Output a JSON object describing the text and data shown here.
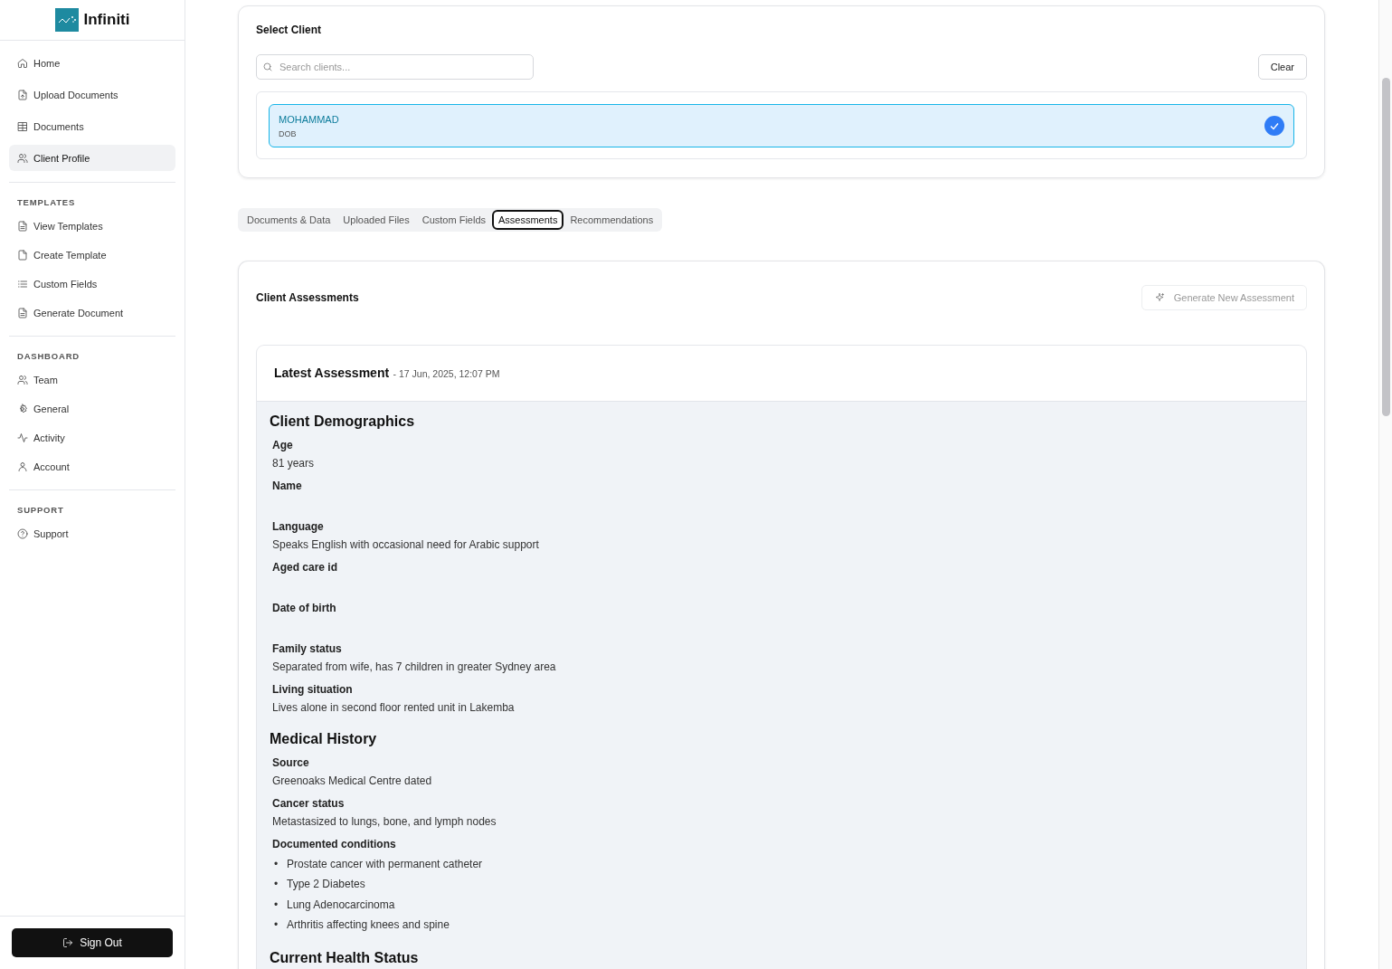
{
  "brand": {
    "name": "Infiniti"
  },
  "sidebar": {
    "items": [
      {
        "label": "Home",
        "selected": false
      },
      {
        "label": "Upload Documents",
        "selected": false
      },
      {
        "label": "Documents",
        "selected": false
      },
      {
        "label": "Client Profile",
        "selected": true
      }
    ],
    "sections": [
      {
        "title": "TEMPLATES",
        "items": [
          {
            "label": "View Templates",
            "selected": false
          },
          {
            "label": "Create Template",
            "selected": false
          },
          {
            "label": "Custom Fields",
            "selected": false
          },
          {
            "label": "Generate Document",
            "selected": false
          }
        ]
      },
      {
        "title": "DASHBOARD",
        "items": [
          {
            "label": "Team",
            "selected": false
          },
          {
            "label": "General",
            "selected": false
          },
          {
            "label": "Activity",
            "selected": false
          },
          {
            "label": "Account",
            "selected": false
          }
        ]
      },
      {
        "title": "SUPPORT",
        "items": [
          {
            "label": "Support",
            "selected": false
          }
        ]
      }
    ],
    "sign_out": "Sign Out"
  },
  "select_client": {
    "title": "Select Client",
    "search": {
      "placeholder": "Search clients..."
    },
    "clear_button": "Clear",
    "clients": [
      {
        "name": "MOHAMMAD",
        "detail": "DOB",
        "selected": true
      }
    ]
  },
  "tabs": [
    {
      "label": "Documents & Data",
      "selected": false
    },
    {
      "label": "Uploaded Files",
      "selected": false
    },
    {
      "label": "Custom Fields",
      "selected": false
    },
    {
      "label": "Assessments",
      "selected": true
    },
    {
      "label": "Recommendations",
      "selected": false
    }
  ],
  "assessments": {
    "title": "Client Assessments",
    "generate_button": "Generate New Assessment",
    "generate_disabled": true,
    "latest": {
      "title": "Latest Assessment",
      "date": "- 17 Jun, 2025, 12:07 PM",
      "sections": [
        {
          "title": "Client Demographics",
          "fields": [
            {
              "label": "Age",
              "value": "81 years"
            },
            {
              "label": "Name"
            },
            {
              "label": "Language",
              "value": "Speaks English with occasional need for Arabic support"
            },
            {
              "label": "Aged care id"
            },
            {
              "label": "Date of birth"
            },
            {
              "label": "Family status",
              "value": "Separated from wife, has 7 children in greater Sydney area"
            },
            {
              "label": "Living situation",
              "value": "Lives alone in second floor rented unit in Lakemba"
            }
          ]
        },
        {
          "title": "Medical History",
          "fields": [
            {
              "label": "Source",
              "value": "Greenoaks Medical Centre dated"
            },
            {
              "label": "Cancer status",
              "value": "Metastasized to lungs, bone, and lymph nodes"
            },
            {
              "label": "Documented conditions",
              "list": [
                {
                  "bullet": "•",
                  "text": "Prostate cancer with permanent catheter"
                },
                {
                  "bullet": "•",
                  "text": "Type 2 Diabetes"
                },
                {
                  "bullet": "•",
                  "text": "Lung Adenocarcinoma"
                },
                {
                  "bullet": "•",
                  "text": "Arthritis affecting knees and spine"
                }
              ]
            }
          ]
        },
        {
          "title": "Current Health Status"
        }
      ]
    }
  }
}
